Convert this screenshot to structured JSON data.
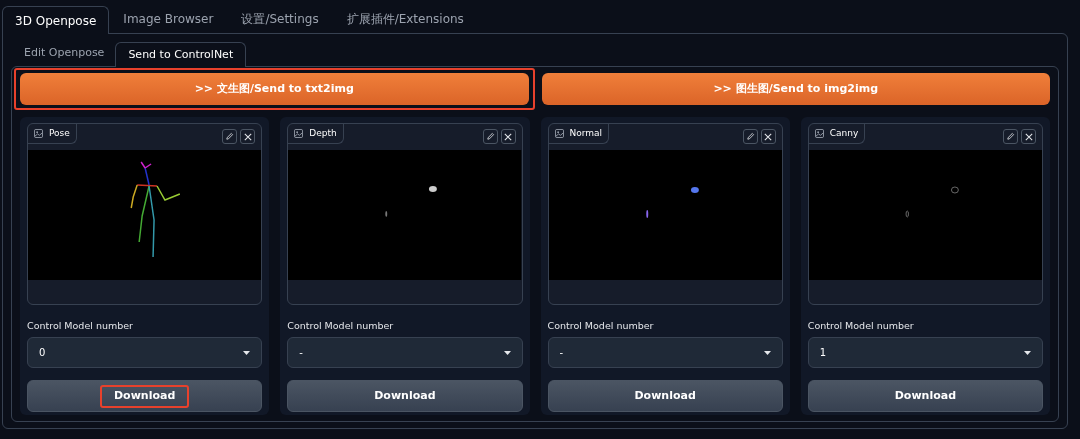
{
  "tabs": [
    {
      "label": "3D Openpose",
      "selected": true
    },
    {
      "label": "Image Browser",
      "selected": false
    },
    {
      "label": "设置/Settings",
      "selected": false
    },
    {
      "label": "扩展插件/Extensions",
      "selected": false
    }
  ],
  "subtabs": [
    {
      "label": "Edit Openpose",
      "selected": false
    },
    {
      "label": "Send to ControlNet",
      "selected": true
    }
  ],
  "send_buttons": [
    {
      "label": ">> 文生图/Send to txt2img",
      "highlighted": true
    },
    {
      "label": ">> 图生图/Send to img2img",
      "highlighted": false
    }
  ],
  "panels": [
    {
      "image_label": "Pose",
      "model_label": "Control Model number",
      "model_value": "0",
      "download": "Download",
      "download_highlighted": true
    },
    {
      "image_label": "Depth",
      "model_label": "Control Model number",
      "model_value": "-",
      "download": "Download",
      "download_highlighted": false
    },
    {
      "image_label": "Normal",
      "model_label": "Control Model number",
      "model_value": "-",
      "download": "Download",
      "download_highlighted": false
    },
    {
      "image_label": "Canny",
      "model_label": "Control Model number",
      "model_value": "1",
      "download": "Download",
      "download_highlighted": false
    }
  ]
}
